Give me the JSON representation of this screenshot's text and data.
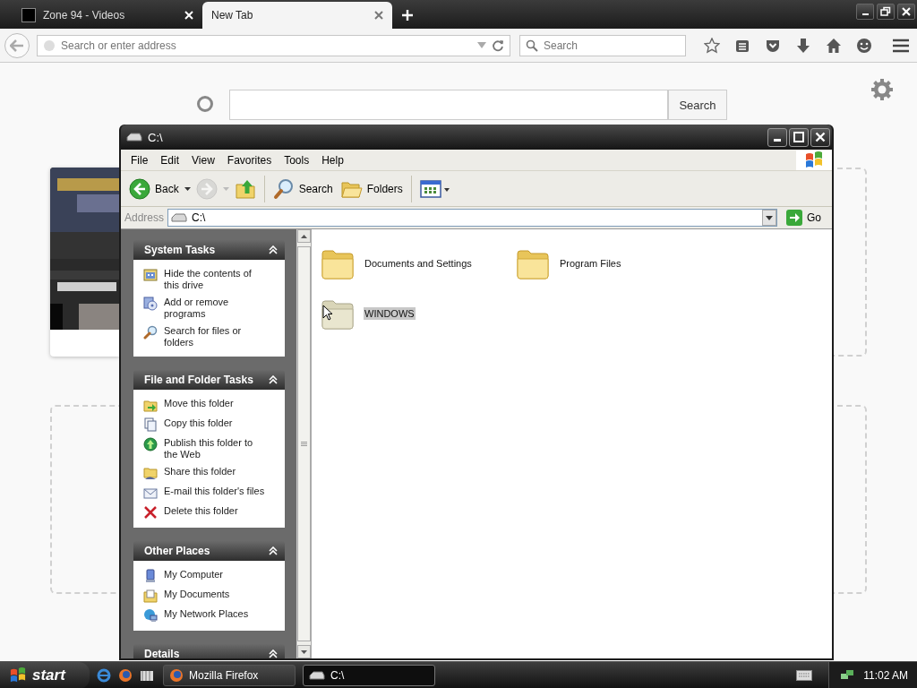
{
  "browser": {
    "tabs": [
      {
        "title": "Zone 94 - Videos",
        "selected": false
      },
      {
        "title": "New Tab",
        "selected": true
      }
    ],
    "address": {
      "placeholder": "Search or enter address"
    },
    "search": {
      "placeholder": "Search"
    },
    "newtab": {
      "search_button": "Search"
    }
  },
  "explorer": {
    "title": "C:\\",
    "menu": [
      "File",
      "Edit",
      "View",
      "Favorites",
      "Tools",
      "Help"
    ],
    "toolbar": [
      {
        "kind": "back",
        "label": "Back",
        "disabled": false
      },
      {
        "kind": "forward",
        "disabled": true
      },
      {
        "kind": "up",
        "disabled": false
      },
      {
        "kind": "search",
        "label": "Search",
        "disabled": false
      },
      {
        "kind": "folders",
        "label": "Folders",
        "disabled": false
      },
      {
        "kind": "views",
        "disabled": false
      }
    ],
    "address_label": "Address",
    "address": "C:\\",
    "go": "Go",
    "panels": [
      {
        "title": "System Tasks",
        "expanded": true,
        "items": [
          {
            "kind": "hide",
            "label": "Hide the contents of this drive"
          },
          {
            "kind": "programs",
            "label": "Add or remove programs"
          },
          {
            "kind": "search",
            "label": "Search for files or folders"
          }
        ]
      },
      {
        "title": "File and Folder Tasks",
        "expanded": true,
        "items": [
          {
            "kind": "move",
            "label": "Move this folder"
          },
          {
            "kind": "copy",
            "label": "Copy this folder"
          },
          {
            "kind": "publish",
            "label": "Publish this folder to the Web"
          },
          {
            "kind": "share",
            "label": "Share this folder"
          },
          {
            "kind": "email",
            "label": "E-mail this folder's files"
          },
          {
            "kind": "delete",
            "label": "Delete this folder"
          }
        ]
      },
      {
        "title": "Other Places",
        "expanded": true,
        "items": [
          {
            "kind": "computer",
            "label": "My Computer"
          },
          {
            "kind": "documents",
            "label": "My Documents"
          },
          {
            "kind": "network",
            "label": "My Network Places"
          }
        ]
      },
      {
        "title": "Details",
        "expanded": true
      }
    ],
    "files": [
      {
        "name": "Documents and Settings",
        "selected": false
      },
      {
        "name": "Program Files",
        "selected": false
      },
      {
        "name": "WINDOWS",
        "selected": true
      }
    ]
  },
  "taskbar": {
    "start": "start",
    "tasks": [
      {
        "kind": "firefox",
        "label": "Mozilla Firefox",
        "selected": false
      },
      {
        "kind": "drive",
        "label": "C:\\",
        "selected": true
      }
    ],
    "clock": "11:02 AM"
  }
}
